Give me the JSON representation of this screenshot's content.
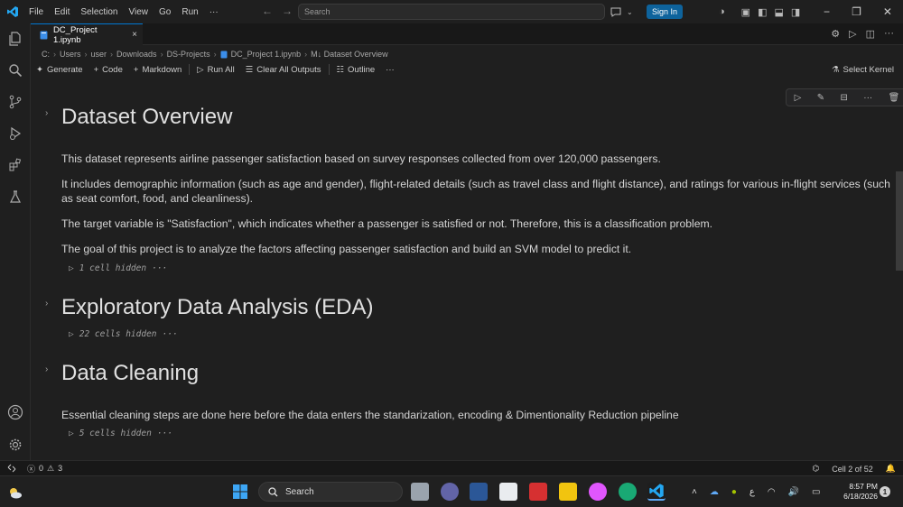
{
  "menu": [
    "File",
    "Edit",
    "Selection",
    "View",
    "Go",
    "Run",
    "···"
  ],
  "search": {
    "placeholder": "Search"
  },
  "signin_label": "Sign In",
  "tab": {
    "label": "DC_Project 1.ipynb",
    "close": "×"
  },
  "breadcrumb": [
    "C:",
    "Users",
    "user",
    "Downloads",
    "DS-Projects",
    "DC_Project 1.ipynb",
    "M↓ Dataset Overview"
  ],
  "toolbar": {
    "generate": "Generate",
    "code": "Code",
    "markdown": "Markdown",
    "run_all": "Run All",
    "clear_outputs": "Clear All Outputs",
    "outline": "Outline",
    "more": "···",
    "select_kernel": "Select Kernel"
  },
  "notebook": {
    "dataset_overview": {
      "heading": "Dataset Overview",
      "p1": "This dataset represents airline passenger satisfaction based on survey responses collected from over 120,000 passengers.",
      "p2": "It includes demographic information (such as age and gender), flight-related details (such as travel class and flight distance), and ratings for various in-flight services (such as seat comfort, food, and cleanliness).",
      "p3": "The target variable is \"Satisfaction\", which indicates whether a passenger is satisfied or not. Therefore, this is a classification problem.",
      "p4": "The goal of this project is to analyze the factors affecting passenger satisfaction and build an SVM model to predict it.",
      "hidden": "1 cell hidden"
    },
    "eda": {
      "heading": "Exploratory Data Analysis (EDA)",
      "hidden": "22 cells hidden"
    },
    "cleaning": {
      "heading": "Data Cleaning",
      "p1": "Essential cleaning steps are done here before the data enters the standarization, encoding & Dimentionality Reduction pipeline",
      "hidden": "5 cells hidden"
    },
    "more_glyph": "···"
  },
  "status": {
    "errors": "0",
    "warnings": "3",
    "cell_position": "Cell 2 of 52"
  },
  "taskbar": {
    "search_label": "Search",
    "tray_lang": "ع",
    "time": "8:57 PM",
    "date": "6/18/2026",
    "notif_count": "1"
  },
  "colors": {
    "accent": "#0078d4",
    "signin": "#0e639c",
    "background": "#1f1f1f"
  }
}
